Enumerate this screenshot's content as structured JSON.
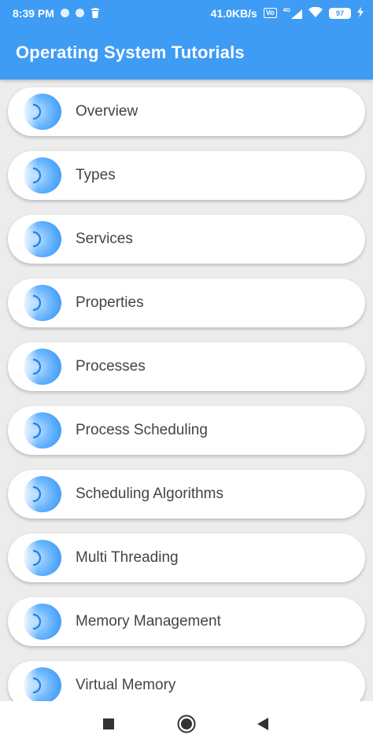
{
  "status_bar": {
    "time": "8:39 PM",
    "speed": "41.0KB/s",
    "network_badge": "4G",
    "battery": "97",
    "icons": [
      "notification-dot-icon",
      "notification-dot-icon",
      "trash-icon",
      "volte-icon",
      "signal-icon",
      "wifi-icon",
      "battery-icon",
      "charging-icon"
    ]
  },
  "app_bar": {
    "title": "Operating System Tutorials"
  },
  "list": {
    "items": [
      {
        "label": "Overview"
      },
      {
        "label": "Types"
      },
      {
        "label": "Services"
      },
      {
        "label": "Properties"
      },
      {
        "label": "Processes"
      },
      {
        "label": "Process Scheduling"
      },
      {
        "label": "Scheduling Algorithms"
      },
      {
        "label": "Multi Threading"
      },
      {
        "label": "Memory Management"
      },
      {
        "label": "Virtual Memory"
      }
    ]
  },
  "nav_bar": {
    "icons": [
      "recents-square-icon",
      "home-circle-icon",
      "back-triangle-icon"
    ]
  },
  "colors": {
    "accent": "#3f9cf4",
    "background": "#ececec",
    "card": "#ffffff",
    "text": "#444444"
  }
}
